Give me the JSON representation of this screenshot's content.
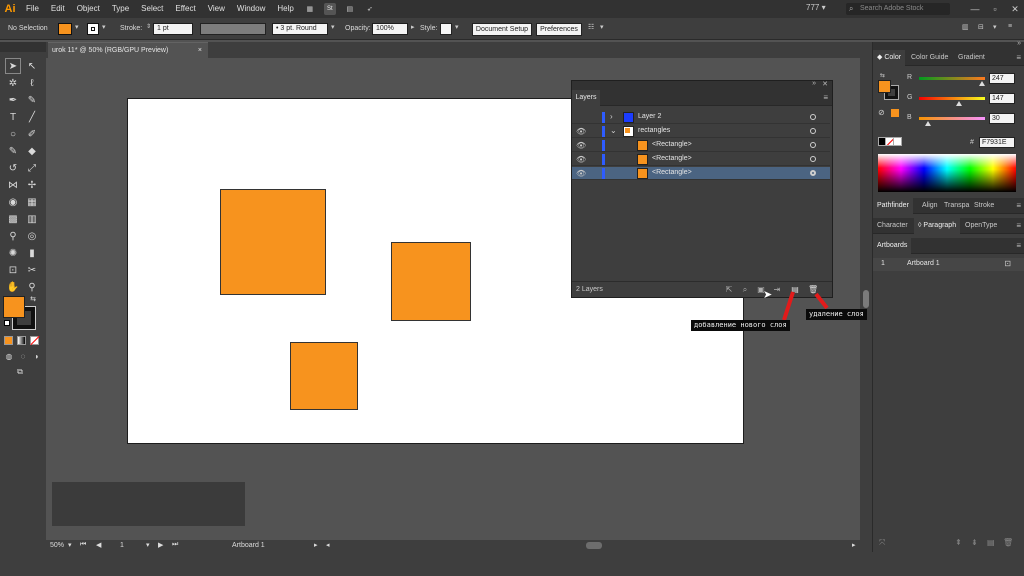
{
  "app": {
    "logo": "Ai"
  },
  "menu": [
    "File",
    "Edit",
    "Object",
    "Type",
    "Select",
    "Effect",
    "View",
    "Window",
    "Help"
  ],
  "menubar": {
    "st_badge": "St",
    "workspace": "777",
    "stock_search_placeholder": "Search Adobe Stock",
    "min": "—",
    "max": "▫",
    "close": "✕"
  },
  "control_bar": {
    "selection": "No Selection",
    "stroke_label": "Stroke:",
    "stroke_weight": "1 pt",
    "brush": "3 pt. Round",
    "opacity_label": "Opacity:",
    "opacity_value": "100%",
    "style_label": "Style:",
    "document_setup": "Document Setup",
    "preferences": "Preferences"
  },
  "document": {
    "tab_title": "urok 11* @ 50% (RGB/GPU Preview)",
    "tab_close": "×"
  },
  "layers_panel": {
    "tab": "Layers",
    "footer_count": "2 Layers",
    "rows": [
      {
        "name": "Layer 2",
        "thumb_color": "#1b3cff"
      },
      {
        "name": "rectangles",
        "thumb_color": "#f7931e"
      },
      {
        "name": "<Rectangle>",
        "thumb_color": "#f7931e"
      },
      {
        "name": "<Rectangle>",
        "thumb_color": "#f7931e"
      },
      {
        "name": "<Rectangle>",
        "thumb_color": "#f7931e"
      }
    ]
  },
  "annotations": {
    "new_layer": "добавление нового слоя",
    "delete_layer": "удаление слоя"
  },
  "color_panel": {
    "tabs": [
      "Color",
      "Color Guide",
      "Gradient"
    ],
    "r_label": "R",
    "r_value": "247",
    "g_label": "G",
    "g_value": "147",
    "b_label": "B",
    "b_value": "30",
    "hex_prefix": "#",
    "hex_value": "F7931E",
    "fill_color": "#f7931e",
    "accent_layer_color": "#2e5cff"
  },
  "panels_mid": {
    "tabs1": [
      "Pathfinder",
      "Align",
      "Transpa",
      "Stroke"
    ],
    "tabs2": [
      "Character",
      "Paragraph",
      "OpenType"
    ],
    "artboards_tab": "Artboards",
    "artboard_num": "1",
    "artboard_name": "Artboard 1"
  },
  "status_bar": {
    "zoom": "50%",
    "artboard_index": "1",
    "artboard_name": "Artboard 1"
  }
}
